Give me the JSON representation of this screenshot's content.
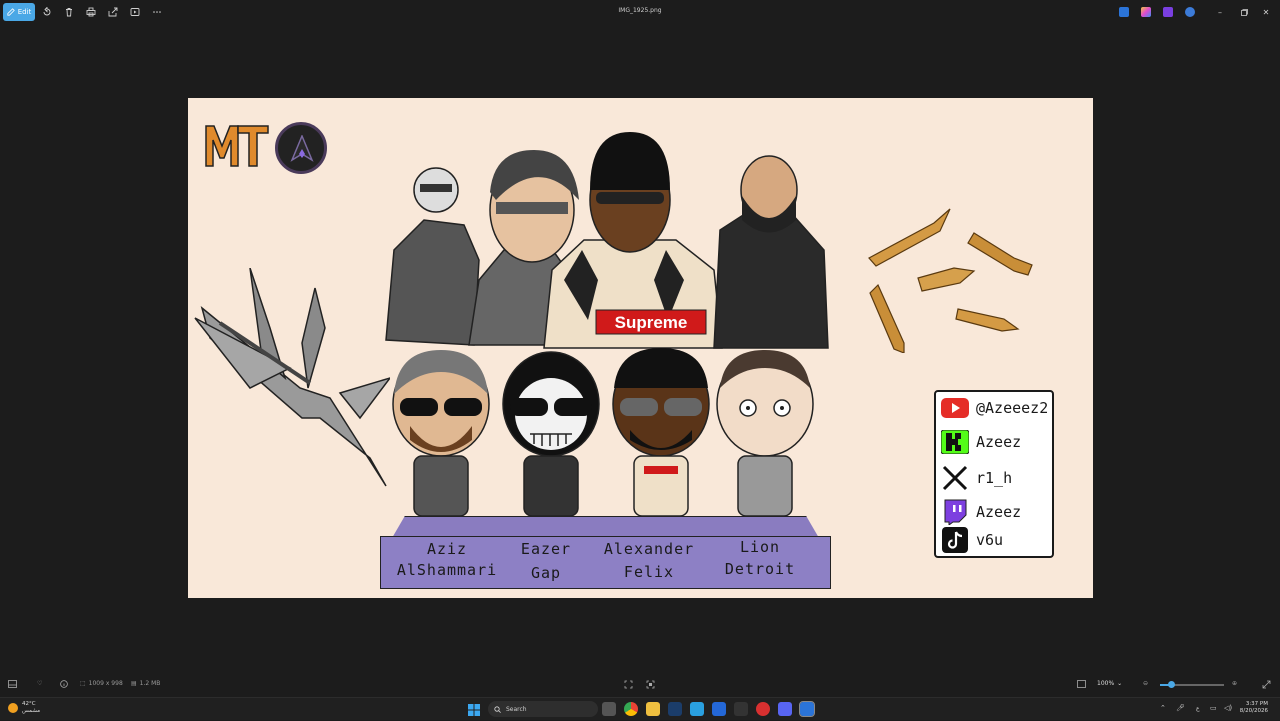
{
  "toolbar": {
    "edit_label": "Edit",
    "file_title": "IMG_1925.png"
  },
  "image": {
    "operator_names": [
      {
        "first": "Aziz",
        "last": "AlShammari"
      },
      {
        "first": "Eazer",
        "last": "Gap"
      },
      {
        "first": "Alexander",
        "last": "Felix"
      },
      {
        "first": "Lion",
        "last": "Detroit"
      }
    ],
    "shirt_brand": "Supreme",
    "socials": [
      {
        "platform": "youtube-icon",
        "handle": "@Azeeez2",
        "color": "#e52d27"
      },
      {
        "platform": "kick-icon",
        "handle": "Azeez",
        "color": "#53fc18"
      },
      {
        "platform": "x-icon",
        "handle": "r1_h",
        "color": "#111111"
      },
      {
        "platform": "twitch-icon",
        "handle": "Azeez",
        "color": "#7d3fe0"
      },
      {
        "platform": "tiktok-icon",
        "handle": "v6u",
        "color": "#111111"
      }
    ]
  },
  "statusbar": {
    "dimensions": "1009 x 998",
    "file_size": "1.2 MB",
    "zoom": "100%",
    "zoom_fraction": 0.18
  },
  "taskbar": {
    "weather_temp": "42°C",
    "weather_desc": "مشمس",
    "search_placeholder": "Search",
    "lang": "ع",
    "time": "3:37 PM",
    "date": "8/20/2026"
  },
  "colors": {
    "accent": "#4aa8e6",
    "canvas_bg": "#f9e8d9",
    "pedestal": "#8d80c5"
  }
}
